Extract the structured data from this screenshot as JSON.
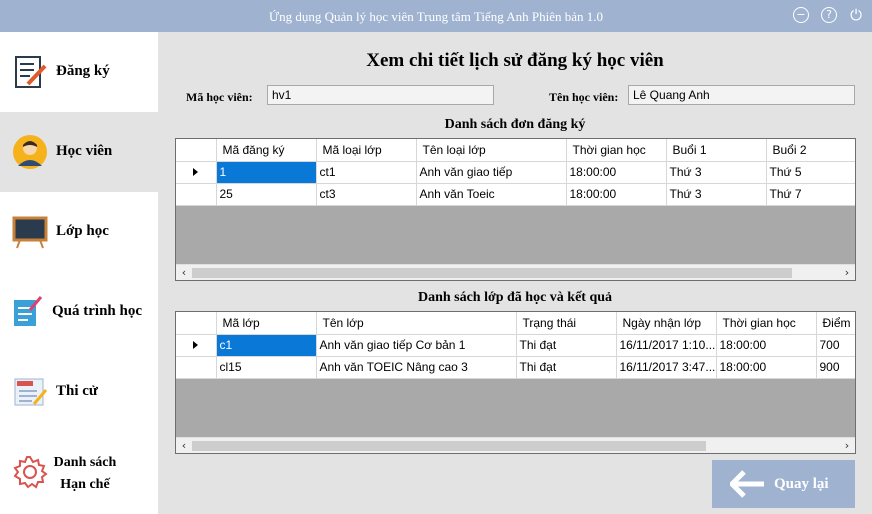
{
  "window": {
    "title": "Ứng dụng Quản lý học viên Trung tâm Tiếng Anh Phiên bản 1.0",
    "minimize_glyph": "−",
    "help_glyph": "?",
    "power_glyph": "⏻"
  },
  "sidebar": {
    "items": [
      {
        "label": "Đăng ký",
        "icon": "register-icon"
      },
      {
        "label": "Học viên",
        "icon": "student-icon"
      },
      {
        "label": "Lớp học",
        "icon": "classroom-board-icon"
      },
      {
        "label": "Quá trình học",
        "icon": "learning-progress-icon"
      },
      {
        "label": "Thi cử",
        "icon": "exam-icon"
      },
      {
        "label_line1": "Danh sách",
        "label_line2": "Hạn chế",
        "icon": "gear-icon"
      }
    ],
    "active_index": 1
  },
  "main": {
    "title": "Xem chi tiết lịch sử đăng ký học viên",
    "student_id_label": "Mã học viên:",
    "student_id_value": "hv1",
    "student_name_label": "Tên học viên:",
    "student_name_value": "Lê Quang Anh",
    "registrations": {
      "title": "Danh sách đơn đăng ký",
      "columns": [
        "Mã đăng ký",
        "Mã loại lớp",
        "Tên loại lớp",
        "Thời gian học",
        "Buổi 1",
        "Buổi 2"
      ],
      "rows": [
        [
          "1",
          "ct1",
          "Anh văn giao tiếp",
          "18:00:00",
          "Thứ 3",
          "Thứ 5"
        ],
        [
          "25",
          "ct3",
          "Anh văn Toeic",
          "18:00:00",
          "Thứ 3",
          "Thứ 7"
        ]
      ]
    },
    "classes": {
      "title": "Danh sách lớp đã học và kết quả",
      "columns": [
        "Mã lớp",
        "Tên lớp",
        "Trạng thái",
        "Ngày nhận lớp",
        "Thời gian học",
        "Điểm"
      ],
      "rows": [
        [
          "c1",
          "Anh văn giao tiếp Cơ bản 1",
          "Thi đạt",
          "16/11/2017 1:10...",
          "18:00:00",
          "700"
        ],
        [
          "cl15",
          "Anh văn TOEIC Nâng cao 3",
          "Thi đạt",
          "16/11/2017 3:47...",
          "18:00:00",
          "900"
        ]
      ]
    },
    "back_button_label": "Quay lại"
  },
  "colors": {
    "accent": "#9fb3d1",
    "selected_cell": "#0a78d7",
    "panel_background": "#e3e3e3"
  }
}
